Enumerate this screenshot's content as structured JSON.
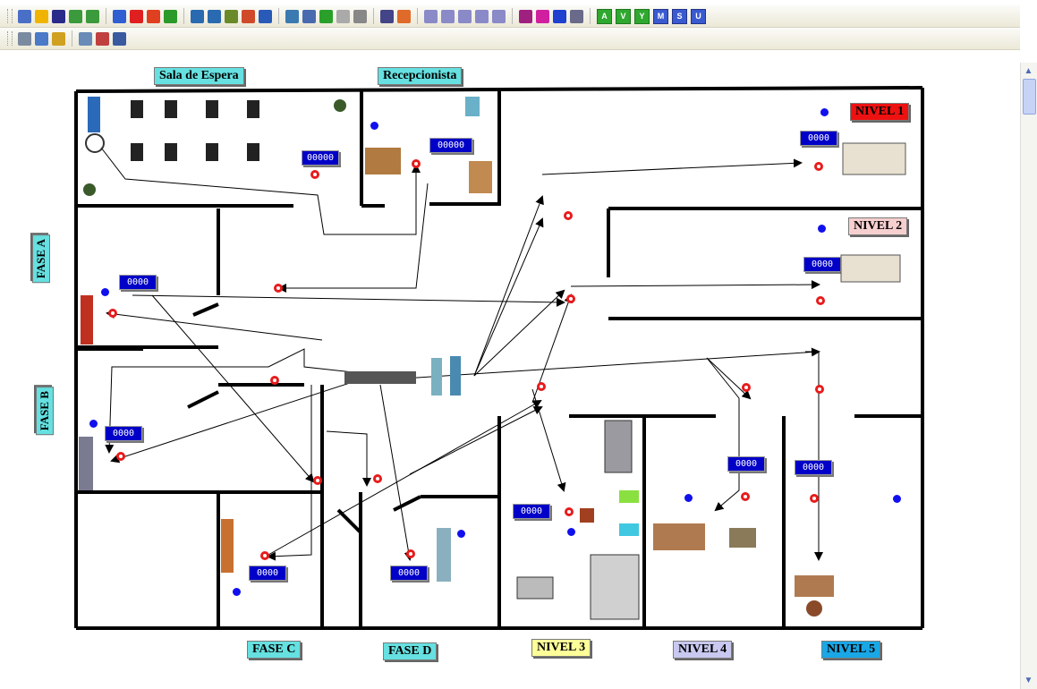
{
  "labels": {
    "sala_espera": "Sala de Espera",
    "recepcionista": "Recepcionista",
    "nivel1": "NIVEL 1",
    "nivel2": "NIVEL 2",
    "nivel3": "NIVEL 3",
    "nivel4": "NIVEL 4",
    "nivel5": "NIVEL 5",
    "fase_a": "FASE A",
    "fase_b": "FASE B",
    "fase_c": "FASE C",
    "fase_d": "FASE D"
  },
  "counters": {
    "sala": "00000",
    "recep": "00000",
    "nivel1": "0000",
    "nivel2": "0000",
    "fase_a": "0000",
    "fase_b": "0000",
    "fase_c": "0000",
    "fase_d": "0000",
    "nivel3": "0000",
    "nivel4": "0000",
    "nivel5": "0000"
  },
  "label_colors": {
    "cyan": "#66e0e0",
    "nivel1": "#ee1111",
    "nivel2": "#f6cfcf",
    "nivel3": "#ffff9a",
    "nivel4": "#c8c8f0",
    "nivel5": "#19a7e6"
  },
  "toolbar_icons": [
    "new-document-icon",
    "shield-icon",
    "save-icon",
    "build-icon",
    "export-icon",
    "diamond-icon",
    "circle-icon",
    "arrow-icon",
    "flag-icon",
    "location-icon",
    "resource-icon",
    "path-icon",
    "timer-icon",
    "info-icon",
    "run-icon",
    "copy-icon",
    "play-icon",
    "pause-icon",
    "stop-icon",
    "grid-icon",
    "chart-icon",
    "fork-icon",
    "join-icon",
    "merge-icon",
    "edit-icon",
    "route-icon",
    "palette-icon",
    "pie-icon",
    "triangle-icon",
    "entity-icon"
  ],
  "toolbar_letters": [
    "A",
    "V",
    "Y",
    "M",
    "S",
    "U"
  ],
  "toolbar2_icons": [
    "camera-icon",
    "window-icon",
    "zoom-icon",
    "table-icon",
    "graph-icon",
    "layout-icon"
  ]
}
